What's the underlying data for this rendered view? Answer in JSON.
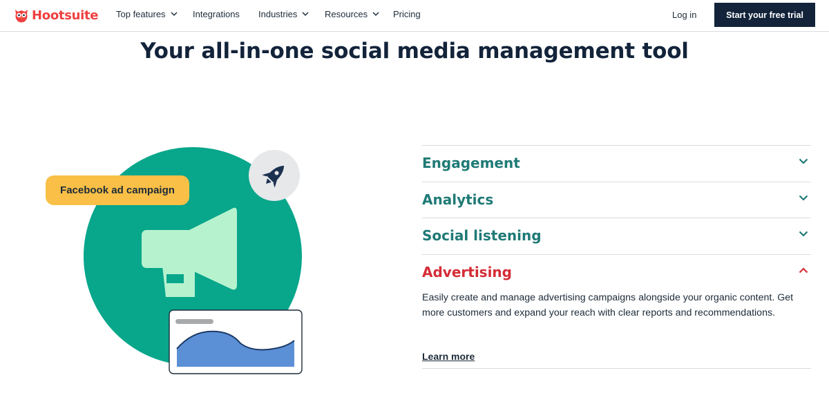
{
  "brand": {
    "name": "Hootsuite",
    "accent": "#ef3f3f",
    "dark": "#12233a",
    "teal": "#1f7a76",
    "red": "#d42c36"
  },
  "nav": {
    "items": [
      {
        "label": "Top features",
        "dropdown": true
      },
      {
        "label": "Integrations",
        "dropdown": false
      },
      {
        "label": "Industries",
        "dropdown": true
      },
      {
        "label": "Resources",
        "dropdown": true
      },
      {
        "label": "Pricing",
        "dropdown": false
      }
    ],
    "login": "Log in",
    "cta": "Start your free trial"
  },
  "headline": "Your all-in-one social media management tool",
  "illustration": {
    "pill_label": "Facebook ad campaign",
    "icons": [
      "rocket-icon",
      "megaphone-icon",
      "area-chart-icon"
    ]
  },
  "accordion": {
    "items": [
      {
        "title": "Engagement",
        "open": false
      },
      {
        "title": "Analytics",
        "open": false
      },
      {
        "title": "Social listening",
        "open": false
      },
      {
        "title": "Advertising",
        "open": true
      }
    ],
    "open_body": "Easily create and manage advertising campaigns alongside your organic content. Get more customers and expand your reach with clear reports and recommendations.",
    "learn_more": "Learn more"
  }
}
